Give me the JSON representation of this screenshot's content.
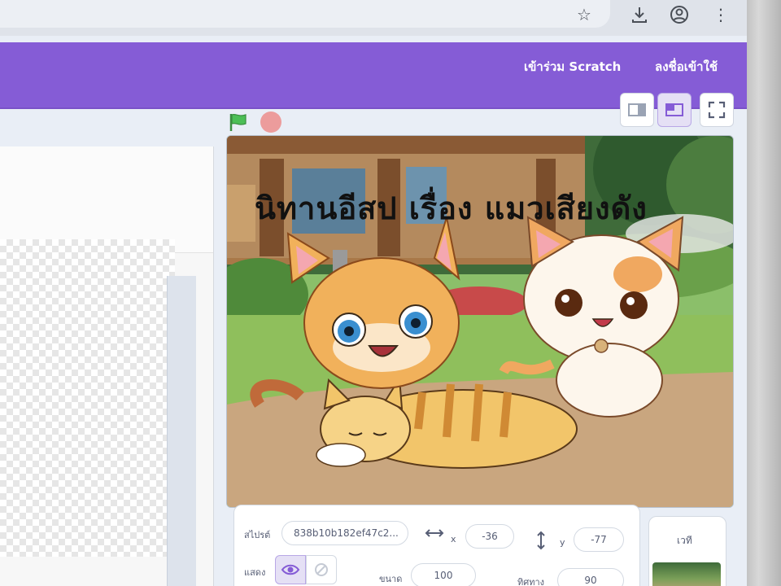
{
  "menu_bar": {
    "join_label": "เข้าร่วม Scratch",
    "signin_label": "ลงชื่อเข้าใช้"
  },
  "stage": {
    "title_text": "นิทานอีสป  เรื่อง   แมวเสียงดัง"
  },
  "sprite_info": {
    "sprite_label": "สไปรต์",
    "sprite_name": "838b10b182ef47c2...",
    "x_label": "x",
    "x_value": "-36",
    "y_label": "y",
    "y_value": "-77",
    "show_label": "แสดง",
    "size_label": "ขนาด",
    "size_value": "100",
    "direction_label": "ทิศทาง",
    "direction_value": "90"
  },
  "stage_panel": {
    "label": "เวที"
  },
  "colors": {
    "scratch_purple": "#855cd6",
    "green_flag": "#4cbf56",
    "stop": "#ec9c9c"
  },
  "icons": [
    "star-icon",
    "download-icon",
    "account-icon",
    "more-icon",
    "green-flag-icon",
    "stop-icon",
    "small-stage-icon",
    "large-stage-icon",
    "fullscreen-icon",
    "eye-icon",
    "hidden-icon",
    "arrows-horizontal-icon",
    "arrows-vertical-icon"
  ]
}
